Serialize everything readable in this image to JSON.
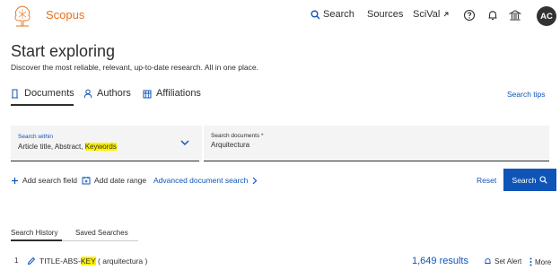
{
  "header": {
    "brand": "Scopus",
    "nav_search": "Search",
    "nav_sources": "Sources",
    "nav_scival": "SciVal",
    "avatar_initials": "AC",
    "icons": [
      "elsevier-tree-logo",
      "search-icon",
      "external-link-icon",
      "help-icon",
      "bell-icon",
      "institution-icon"
    ]
  },
  "hero": {
    "title": "Start exploring",
    "subtitle": "Discover the most reliable, relevant, up-to-date research. All in one place."
  },
  "tabs": {
    "documents": "Documents",
    "authors": "Authors",
    "affiliations": "Affiliations",
    "search_tips": "Search tips"
  },
  "search_form": {
    "within_label": "Search within",
    "within_value_prefix": "Article title, Abstract, ",
    "within_value_highlight": "Keywords",
    "documents_label": "Search documents *",
    "documents_value": "Arquitectura"
  },
  "actions": {
    "add_field": "Add search field",
    "add_date": "Add date range",
    "advanced": "Advanced document search",
    "reset": "Reset",
    "search": "Search"
  },
  "history_tabs": {
    "history": "Search History",
    "saved": "Saved Searches"
  },
  "history_rows": [
    {
      "num": "1",
      "query_prefix": "TITLE-ABS-",
      "query_highlight": "KEY",
      "query_suffix": " ( arquitectura )",
      "results": "1,649 results",
      "set_alert": "Set Alert",
      "more": "More"
    }
  ],
  "colors": {
    "brand_orange": "#e9711c",
    "link_blue": "#0e55b7",
    "highlight": "#fff200",
    "text_dark": "#2e2e2e"
  }
}
